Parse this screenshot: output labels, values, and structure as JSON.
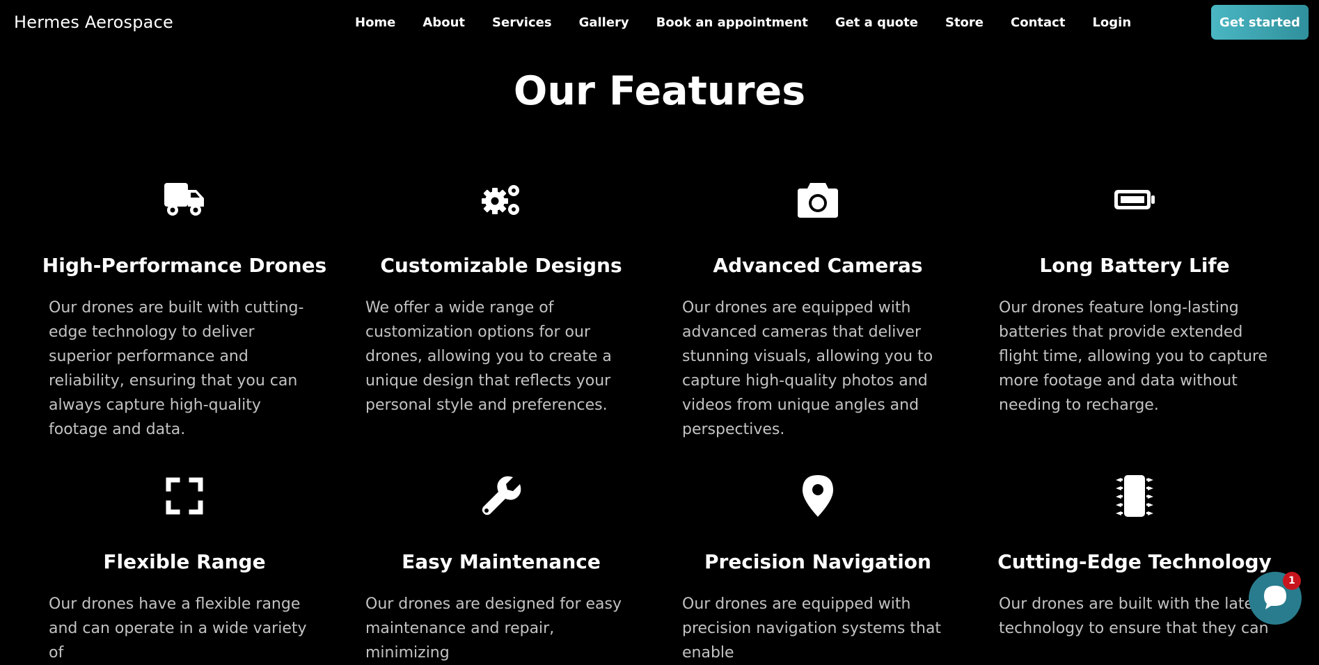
{
  "brand": "Hermes Aerospace",
  "nav": [
    {
      "label": "Home"
    },
    {
      "label": "About"
    },
    {
      "label": "Services"
    },
    {
      "label": "Gallery"
    },
    {
      "label": "Book an appointment"
    },
    {
      "label": "Get a quote"
    },
    {
      "label": "Store"
    },
    {
      "label": "Contact"
    },
    {
      "label": "Login"
    }
  ],
  "cta_label": "Get started",
  "section_title": "Our Features",
  "features": [
    {
      "icon": "truck-icon",
      "title": "High-Performance Drones",
      "description": "Our drones are built with cutting-edge technology to deliver superior performance and reliability, ensuring that you can always capture high-quality footage and data."
    },
    {
      "icon": "gears-icon",
      "title": "Customizable Designs",
      "description": "We offer a wide range of customization options for our drones, allowing you to create a unique design that reflects your personal style and preferences."
    },
    {
      "icon": "camera-icon",
      "title": "Advanced Cameras",
      "description": "Our drones are equipped with advanced cameras that deliver stunning visuals, allowing you to capture high-quality photos and videos from unique angles and perspectives."
    },
    {
      "icon": "battery-icon",
      "title": "Long Battery Life",
      "description": "Our drones feature long-lasting batteries that provide extended flight time, allowing you to capture more footage and data without needing to recharge."
    },
    {
      "icon": "expand-icon",
      "title": "Flexible Range",
      "description": "Our drones have a flexible range and can operate in a wide variety of"
    },
    {
      "icon": "wrench-icon",
      "title": "Easy Maintenance",
      "description": "Our drones are designed for easy maintenance and repair, minimizing"
    },
    {
      "icon": "location-pin-icon",
      "title": "Precision Navigation",
      "description": "Our drones are equipped with precision navigation systems that enable"
    },
    {
      "icon": "microchip-icon",
      "title": "Cutting-Edge Technology",
      "description": "Our drones are built with the latest technology to ensure that they can"
    }
  ],
  "chat": {
    "icon": "chat-icon",
    "badge_count": "1"
  },
  "colors": {
    "background": "#000000",
    "accent_start": "#4ab7c3",
    "accent_end": "#2f909c",
    "chat": "#297c8d",
    "badge": "#c8151d",
    "body_text": "#c3c3c3"
  }
}
